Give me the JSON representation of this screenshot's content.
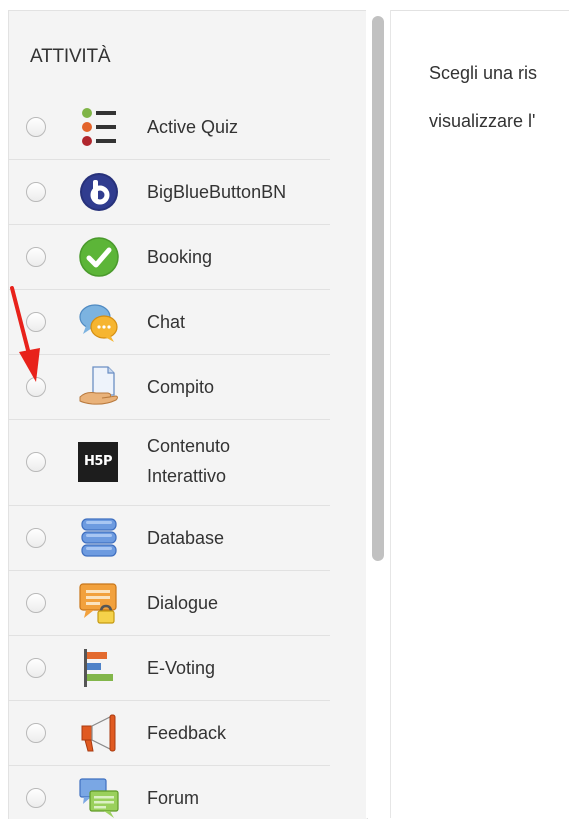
{
  "activities": {
    "heading": "ATTIVITÀ",
    "items": [
      {
        "label": "Active Quiz",
        "icon": "active-quiz-icon"
      },
      {
        "label": "BigBlueButtonBN",
        "icon": "bigbluebutton-icon"
      },
      {
        "label": "Booking",
        "icon": "booking-check-icon"
      },
      {
        "label": "Chat",
        "icon": "chat-bubbles-icon"
      },
      {
        "label": "Compito",
        "icon": "assignment-hand-icon"
      },
      {
        "label_line1": "Contenuto",
        "label_line2": "Interattivo",
        "icon": "h5p-icon",
        "icon_text": "H5P"
      },
      {
        "label": "Database",
        "icon": "database-icon"
      },
      {
        "label": "Dialogue",
        "icon": "dialogue-lock-icon"
      },
      {
        "label": "E-Voting",
        "icon": "evoting-bars-icon"
      },
      {
        "label": "Feedback",
        "icon": "megaphone-icon"
      },
      {
        "label": "Forum",
        "icon": "forum-bubbles-icon"
      }
    ]
  },
  "description": {
    "line1": "Scegli una ris",
    "line2": "visualizzare l'"
  },
  "annotation": {
    "icon": "red-arrow-icon",
    "color": "#e8221b"
  },
  "colors": {
    "panel_bg": "#f4f4f4",
    "text": "#333333",
    "scrollbar": "#c1c1c1"
  }
}
